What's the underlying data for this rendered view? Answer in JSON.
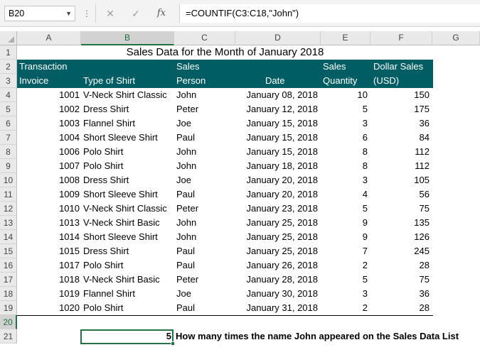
{
  "formula_bar": {
    "name_box": "B20",
    "cancel": "✕",
    "enter": "✓",
    "fx": "fx",
    "formula": "=COUNTIF(C3:C18,\"John\")"
  },
  "columns": [
    "A",
    "B",
    "C",
    "D",
    "E",
    "F",
    "G"
  ],
  "rows": [
    "1",
    "2",
    "3",
    "4",
    "5",
    "6",
    "7",
    "8",
    "9",
    "10",
    "11",
    "12",
    "13",
    "14",
    "15",
    "16",
    "17",
    "18",
    "19",
    "20",
    "21"
  ],
  "sheet": {
    "title": "Sales Data for the Month of January 2018",
    "headers_line1": [
      "Transaction",
      "",
      "Sales",
      "",
      "Sales",
      "Dollar Sales"
    ],
    "headers_line2": [
      "Invoice",
      "Type of Shirt",
      "Person",
      "Date",
      "Quantity",
      "(USD)"
    ],
    "data": [
      [
        "1001",
        "V-Neck Shirt Classic",
        "John",
        "January 08, 2018",
        "10",
        "150"
      ],
      [
        "1002",
        "Dress Shirt",
        "Peter",
        "January 12, 2018",
        "5",
        "175"
      ],
      [
        "1003",
        "Flannel Shirt",
        "Joe",
        "January 15, 2018",
        "3",
        "36"
      ],
      [
        "1004",
        "Short Sleeve Shirt",
        "Paul",
        "January 15, 2018",
        "6",
        "84"
      ],
      [
        "1006",
        "Polo Shirt",
        "John",
        "January 15, 2018",
        "8",
        "112"
      ],
      [
        "1007",
        "Polo Shirt",
        "John",
        "January 18, 2018",
        "8",
        "112"
      ],
      [
        "1008",
        "Dress Shirt",
        "Joe",
        "January 20, 2018",
        "3",
        "105"
      ],
      [
        "1009",
        "Short Sleeve Shirt",
        "Paul",
        "January 20, 2018",
        "4",
        "56"
      ],
      [
        "1010",
        "V-Neck Shirt Classic",
        "Peter",
        "January 23, 2018",
        "5",
        "75"
      ],
      [
        "1013",
        "V-Neck Shirt Basic",
        "John",
        "January 25, 2018",
        "9",
        "135"
      ],
      [
        "1014",
        "Short Sleeve Shirt",
        "John",
        "January 25, 2018",
        "9",
        "126"
      ],
      [
        "1015",
        "Dress Shirt",
        "Paul",
        "January 25, 2018",
        "7",
        "245"
      ],
      [
        "1017",
        "Polo Shirt",
        "Paul",
        "January 26, 2018",
        "2",
        "28"
      ],
      [
        "1018",
        "V-Neck Shirt Basic",
        "Peter",
        "January 28, 2018",
        "5",
        "75"
      ],
      [
        "1019",
        "Flannel Shirt",
        "Joe",
        "January 30, 2018",
        "3",
        "36"
      ],
      [
        "1020",
        "Polo Shirt",
        "Paul",
        "January 31, 2018",
        "2",
        "28"
      ]
    ],
    "result_value": "5",
    "result_note": "How many times the name John  appeared on the Sales Data List"
  },
  "colors": {
    "header_fill": "#005d63",
    "selection": "#217346"
  }
}
